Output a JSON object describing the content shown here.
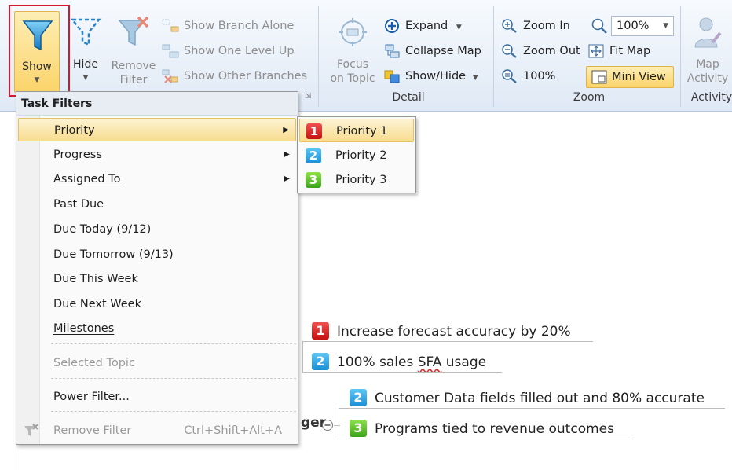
{
  "ribbon": {
    "show_label": "Show",
    "hide_label": "Hide",
    "remove_filter_label": [
      "Remove",
      "Filter"
    ],
    "show_branch_alone": "Show Branch Alone",
    "show_one_level_up": "Show One Level Up",
    "show_other_branches": "Show Other Branches",
    "focus_on_topic": [
      "Focus",
      "on Topic"
    ],
    "expand": "Expand",
    "collapse_map": "Collapse Map",
    "show_hide": "Show/Hide",
    "detail_group": "Detail",
    "zoom_in": "Zoom In",
    "zoom_out": "Zoom Out",
    "zoom_100": "100%",
    "zoom_value": "100%",
    "fit_map": "Fit Map",
    "mini_view": "Mini View",
    "zoom_group": "Zoom",
    "map_activity": [
      "Map",
      "Activity"
    ],
    "activity_group": "Activity"
  },
  "menu": {
    "header": "Task Filters",
    "items": [
      {
        "label": "Priority",
        "submenu": true
      },
      {
        "label": "Progress",
        "submenu": true
      },
      {
        "label": "Assigned To",
        "submenu": true
      },
      {
        "label": "Past Due"
      },
      {
        "label": "Due Today (9/12)"
      },
      {
        "label": "Due Tomorrow (9/13)"
      },
      {
        "label": "Due This Week"
      },
      {
        "label": "Due Next Week"
      },
      {
        "label": "Milestones"
      },
      {
        "label": "Selected Topic",
        "disabled": true
      },
      {
        "label": "Power Filter..."
      },
      {
        "label": "Remove Filter",
        "disabled": true,
        "shortcut": "Ctrl+Shift+Alt+A"
      }
    ]
  },
  "submenu": {
    "items": [
      {
        "badge": "1",
        "label": "Priority 1"
      },
      {
        "badge": "2",
        "label": "Priority 2"
      },
      {
        "badge": "3",
        "label": "Priority 3"
      }
    ]
  },
  "map": {
    "topics": [
      {
        "badge": "1",
        "text": "Increase forecast accuracy by 20%"
      },
      {
        "badge": "2",
        "text_before": "100% sales ",
        "text_sfa": "SFA",
        "text_after": " usage"
      },
      {
        "badge": "2",
        "text": "Customer Data fields filled out and 80% accurate"
      },
      {
        "badge": "3",
        "text": "Programs tied to revenue outcomes"
      }
    ],
    "partial_label": "ger"
  },
  "colors": {
    "priority1": "#d42020",
    "priority2": "#2aa0e6",
    "priority3": "#54bc28",
    "highlight": "#fbd46a",
    "callout": "#d7182a"
  }
}
